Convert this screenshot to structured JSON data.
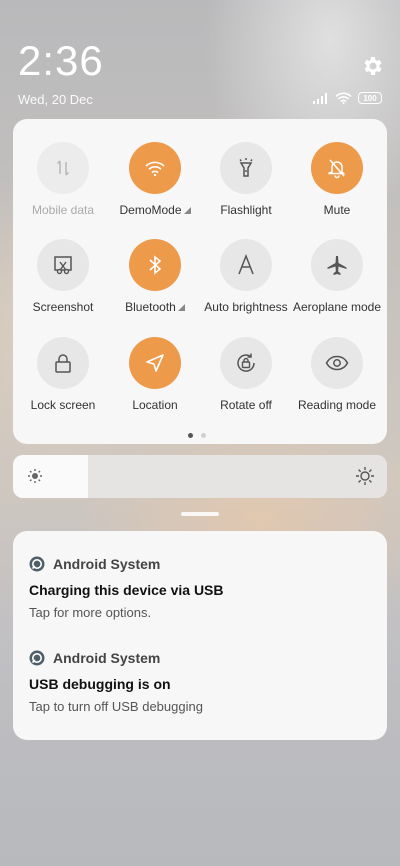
{
  "status_bar": {
    "time": "2:36",
    "date": "Wed, 20 Dec",
    "battery": "100",
    "icons": [
      "settings-gear-icon",
      "signal-icon",
      "wifi-icon",
      "battery-icon"
    ]
  },
  "quick_settings": {
    "tiles": [
      {
        "label": "Mobile data",
        "icon": "mobile-data-icon",
        "state": "disabled"
      },
      {
        "label": "DemoMode",
        "icon": "wifi-icon",
        "state": "on",
        "expandable": true
      },
      {
        "label": "Flashlight",
        "icon": "flashlight-icon",
        "state": "off"
      },
      {
        "label": "Mute",
        "icon": "bell-off-icon",
        "state": "on"
      },
      {
        "label": "Screenshot",
        "icon": "screenshot-icon",
        "state": "off"
      },
      {
        "label": "Bluetooth",
        "icon": "bluetooth-icon",
        "state": "on",
        "expandable": true
      },
      {
        "label": "Auto brightness",
        "icon": "auto-brightness-icon",
        "state": "off"
      },
      {
        "label": "Aeroplane mode",
        "icon": "airplane-icon",
        "state": "off"
      },
      {
        "label": "Lock screen",
        "icon": "lock-icon",
        "state": "off"
      },
      {
        "label": "Location",
        "icon": "location-arrow-icon",
        "state": "on"
      },
      {
        "label": "Rotate off",
        "icon": "rotate-lock-icon",
        "state": "off"
      },
      {
        "label": "Reading mode",
        "icon": "eye-icon",
        "state": "off"
      }
    ],
    "page_index": 1,
    "page_count": 2
  },
  "brightness": {
    "level": 0.2
  },
  "notifications": [
    {
      "app": "Android System",
      "title": "Charging this device via USB",
      "text": "Tap for more options."
    },
    {
      "app": "Android System",
      "title": "USB debugging is on",
      "text": "Tap to turn off USB debugging"
    }
  ],
  "colors": {
    "accent": "#ed9a4b",
    "tile_off": "#e7e7e7",
    "panel": "#f7f7f7"
  }
}
